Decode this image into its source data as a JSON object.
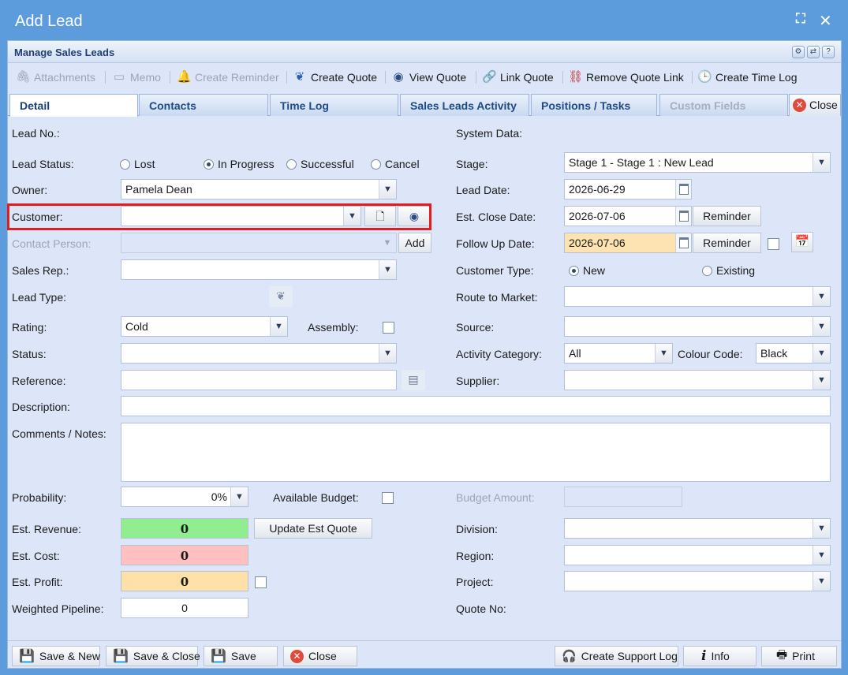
{
  "window": {
    "title": "Add Lead"
  },
  "panel": {
    "title": "Manage Sales Leads"
  },
  "toolbar": {
    "attachments": "Attachments",
    "memo": "Memo",
    "create_reminder": "Create Reminder",
    "create_quote": "Create Quote",
    "view_quote": "View Quote",
    "link_quote": "Link Quote",
    "remove_quote_link": "Remove Quote Link",
    "create_time_log": "Create Time Log"
  },
  "tabs": [
    "Detail",
    "Contacts",
    "Time Log",
    "Sales Leads Activity",
    "Positions / Tasks",
    "Custom Fields"
  ],
  "tab_close": "Close",
  "left": {
    "lead_no": "Lead No.:",
    "lead_status": "Lead Status:",
    "status_options": [
      "Lost",
      "In Progress",
      "Successful",
      "Cancel"
    ],
    "status_selected": "In Progress",
    "owner": "Owner:",
    "owner_value": "Pamela Dean",
    "customer": "Customer:",
    "customer_value": "",
    "contact_person": "Contact Person:",
    "add": "Add",
    "sales_rep": "Sales Rep.:",
    "lead_type": "Lead Type:",
    "rating": "Rating:",
    "rating_value": "Cold",
    "assembly": "Assembly:",
    "status": "Status:",
    "reference": "Reference:",
    "description": "Description:",
    "comments": "Comments / Notes:",
    "probability": "Probability:",
    "probability_value": "0%",
    "available_budget": "Available Budget:",
    "est_revenue": "Est. Revenue:",
    "est_revenue_value": "0",
    "update_est_quote": "Update Est Quote",
    "est_cost": "Est. Cost:",
    "est_cost_value": "0",
    "est_profit": "Est. Profit:",
    "est_profit_value": "0",
    "weighted_pipeline": "Weighted Pipeline:",
    "weighted_pipeline_value": "0"
  },
  "right": {
    "system_data": "System Data:",
    "stage": "Stage:",
    "stage_value": "Stage 1 - Stage 1 : New Lead",
    "lead_date": "Lead Date:",
    "lead_date_value": "2026-06-29",
    "est_close_date": "Est. Close Date:",
    "est_close_date_value": "2026-07-06",
    "reminder": "Reminder",
    "follow_up_date": "Follow Up Date:",
    "follow_up_date_value": "2026-07-06",
    "customer_type": "Customer Type:",
    "customer_type_options": [
      "New",
      "Existing"
    ],
    "customer_type_selected": "New",
    "route_to_market": "Route to Market:",
    "source": "Source:",
    "activity_category": "Activity Category:",
    "activity_category_value": "All",
    "colour_code": "Colour Code:",
    "colour_code_value": "Black",
    "supplier": "Supplier:",
    "budget_amount": "Budget Amount:",
    "division": "Division:",
    "region": "Region:",
    "project": "Project:",
    "quote_no": "Quote No:"
  },
  "footer": {
    "save_new": "Save & New",
    "save_close": "Save & Close",
    "save": "Save",
    "close": "Close",
    "create_support_log": "Create Support Log",
    "info": "Info",
    "print": "Print"
  },
  "colors": {
    "revenue_bg": "#90ee90",
    "cost_bg": "#ffc0c0",
    "profit_bg": "#ffe0a8",
    "followup_bg": "#fde3b2",
    "highlight": "#e31d1d"
  }
}
